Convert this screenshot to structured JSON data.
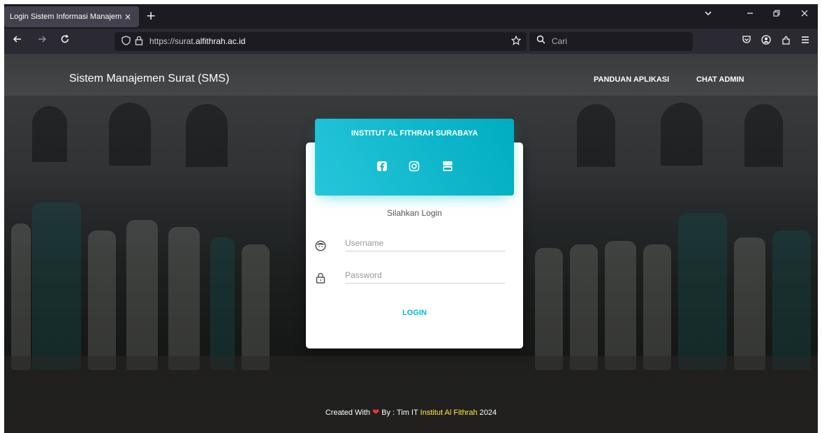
{
  "browser": {
    "tab_title": "Login Sistem Informasi Manajemen",
    "tab_close": "×",
    "new_tab": "+",
    "url_prefix": "https://surat.",
    "url_domain": "alfithrah.ac.id",
    "search_placeholder": "Cari"
  },
  "page": {
    "brand": "Sistem Manajemen Surat (SMS)",
    "nav": [
      "PANDUAN APLIKASI",
      "CHAT ADMIN"
    ],
    "card": {
      "title": "INSTITUT AL FITHRAH SURABAYA",
      "subtitle": "Silahkan Login",
      "username_placeholder": "Username",
      "password_placeholder": "Password",
      "login_label": "LOGIN",
      "social_icons": [
        "facebook-icon",
        "instagram-icon",
        "youtube-icon"
      ]
    },
    "footer": {
      "prefix": "Created With",
      "by": "By : Tim IT",
      "institution": "Institut Al Fithrah",
      "year": "2024"
    }
  },
  "colors": {
    "accent": "#00bcd4",
    "footer_highlight": "#ffeb3b",
    "heart": "#e53935"
  }
}
